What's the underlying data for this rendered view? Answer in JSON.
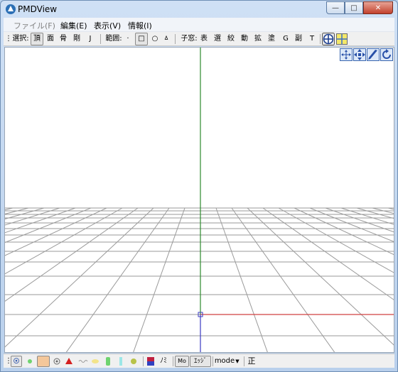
{
  "window": {
    "title": "PMDView"
  },
  "window_buttons": {
    "minimize": "—",
    "maximize": "□",
    "close": "✕"
  },
  "menu": [
    "ファイル(F)",
    "編集(E)",
    "表示(V)",
    "情報(I)"
  ],
  "toolbar": {
    "select_label": "選択:",
    "select_items": [
      "頂",
      "面",
      "骨",
      "剛",
      "J"
    ],
    "range_label": "範囲:",
    "range_items": [
      "·",
      "□",
      "○",
      "ㅿ"
    ],
    "child_label": "子窓:",
    "child_items": [
      "表",
      "選",
      "絞",
      "動",
      "拡",
      "塗",
      "G",
      "副",
      "T"
    ]
  },
  "viewport": {
    "axis_colors": {
      "y": "#2d8a2d",
      "x": "#d04040",
      "z": "#3a3ac0"
    },
    "grid_color": "#9a9a9a"
  },
  "bottom": {
    "mode_label": "mode",
    "mo_label": "Mo",
    "edge_label": "ｴｯｼﾞ",
    "nomi_label": "ﾉﾐ",
    "correct_label": "正"
  },
  "colors": {
    "titlebar": "#c4d8f0",
    "close": "#c2412d"
  }
}
